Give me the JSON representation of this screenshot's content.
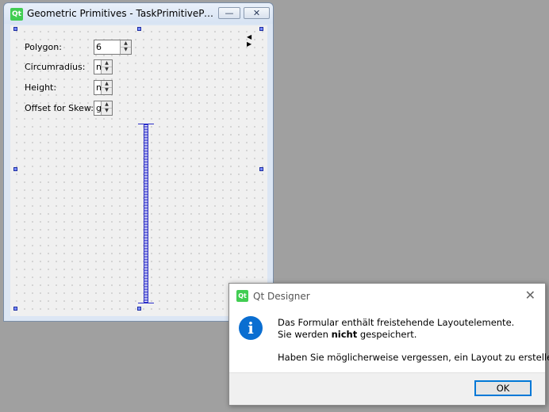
{
  "form_window": {
    "title": "Geometric Primitives - TaskPrimitiveParam...",
    "app_icon": "qt-logo-icon",
    "logo_text": "Qt",
    "minimize_glyph": "—",
    "close_glyph": "✕",
    "nav_arrows": "◀ ▶",
    "fields": [
      {
        "label": "Polygon:",
        "value": "6"
      },
      {
        "label": "Circumradius:",
        "value": "n"
      },
      {
        "label": "Height:",
        "value": "n"
      },
      {
        "label": "Offset for Skew:",
        "value": "g"
      }
    ],
    "spin_up": "▲",
    "spin_down": "▼"
  },
  "dialog": {
    "title": "Qt Designer",
    "logo_text": "Qt",
    "close_glyph": "✕",
    "icon": "info-icon",
    "icon_glyph": "i",
    "message_line1": "Das Formular enthält freistehende Layoutelemente.",
    "message_line2_pre": "Sie werden ",
    "message_line2_bold": "nicht",
    "message_line2_post": " gespeichert.",
    "question": "Haben Sie möglicherweise vergessen, ein Layout zu erstellen?",
    "ok_label": "OK"
  },
  "colors": {
    "desktop": "#a0a0a0",
    "qt_green": "#41cd52",
    "spacer_blue": "#2b2ec8",
    "info_blue": "#0a6ed1",
    "accent": "#0078d7"
  }
}
